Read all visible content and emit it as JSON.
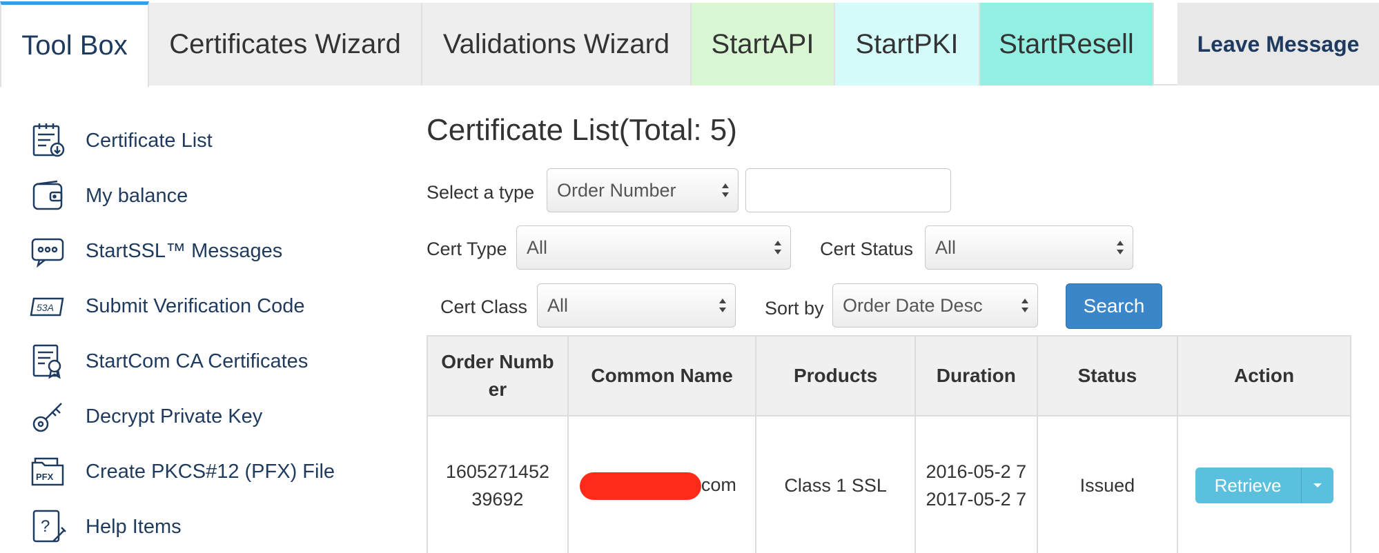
{
  "tabs": [
    {
      "label": "Tool Box",
      "color": "#ffffff"
    },
    {
      "label": "Certificates Wizard",
      "color": "#eeeeee"
    },
    {
      "label": "Validations Wizard",
      "color": "#eeeeee"
    },
    {
      "label": "StartAPI",
      "color": "#d9f7d2"
    },
    {
      "label": "StartPKI",
      "color": "#d6fbfb"
    },
    {
      "label": "StartResell",
      "color": "#94efe3"
    },
    {
      "label": "Leave Message",
      "color": "#e8e8e8"
    }
  ],
  "sidebar": {
    "items": [
      {
        "label": "Certificate List",
        "icon": "certificate-list-icon"
      },
      {
        "label": "My balance",
        "icon": "wallet-icon"
      },
      {
        "label": "StartSSL™ Messages",
        "icon": "message-icon"
      },
      {
        "label": "Submit Verification Code",
        "icon": "verification-code-icon"
      },
      {
        "label": "StartCom CA Certificates",
        "icon": "ca-certificate-icon"
      },
      {
        "label": "Decrypt Private Key",
        "icon": "key-icon"
      },
      {
        "label": "Create PKCS#12 (PFX) File",
        "icon": "pfx-folder-icon"
      },
      {
        "label": "Help Items",
        "icon": "help-icon"
      }
    ]
  },
  "main": {
    "title": "Certificate List(Total: 5)",
    "filters": {
      "select_type_label": "Select a type",
      "select_type_value": "Order Number",
      "search_value": "",
      "cert_type_label": "Cert Type",
      "cert_type_value": "All",
      "cert_status_label": "Cert Status",
      "cert_status_value": "All",
      "cert_class_label": "Cert Class",
      "cert_class_value": "All",
      "sort_by_label": "Sort by",
      "sort_by_value": "Order Date Desc",
      "search_button": "Search"
    },
    "table": {
      "headers": [
        "Order Numb er",
        "Common Name",
        "Products",
        "Duration",
        "Status",
        "Action"
      ],
      "rows": [
        {
          "order_number": "1605271452 39692",
          "common_name_suffix": "com",
          "product": "Class 1 SSL",
          "duration_start": "2016-05-2 7",
          "duration_end": "2017-05-2 7",
          "status": "Issued",
          "action": "Retrieve"
        }
      ]
    }
  },
  "colors": {
    "accent": "#3a86c8",
    "retrieve": "#5bc0de",
    "nav_text": "#1e3a5f",
    "redaction": "#ff2a1a"
  }
}
